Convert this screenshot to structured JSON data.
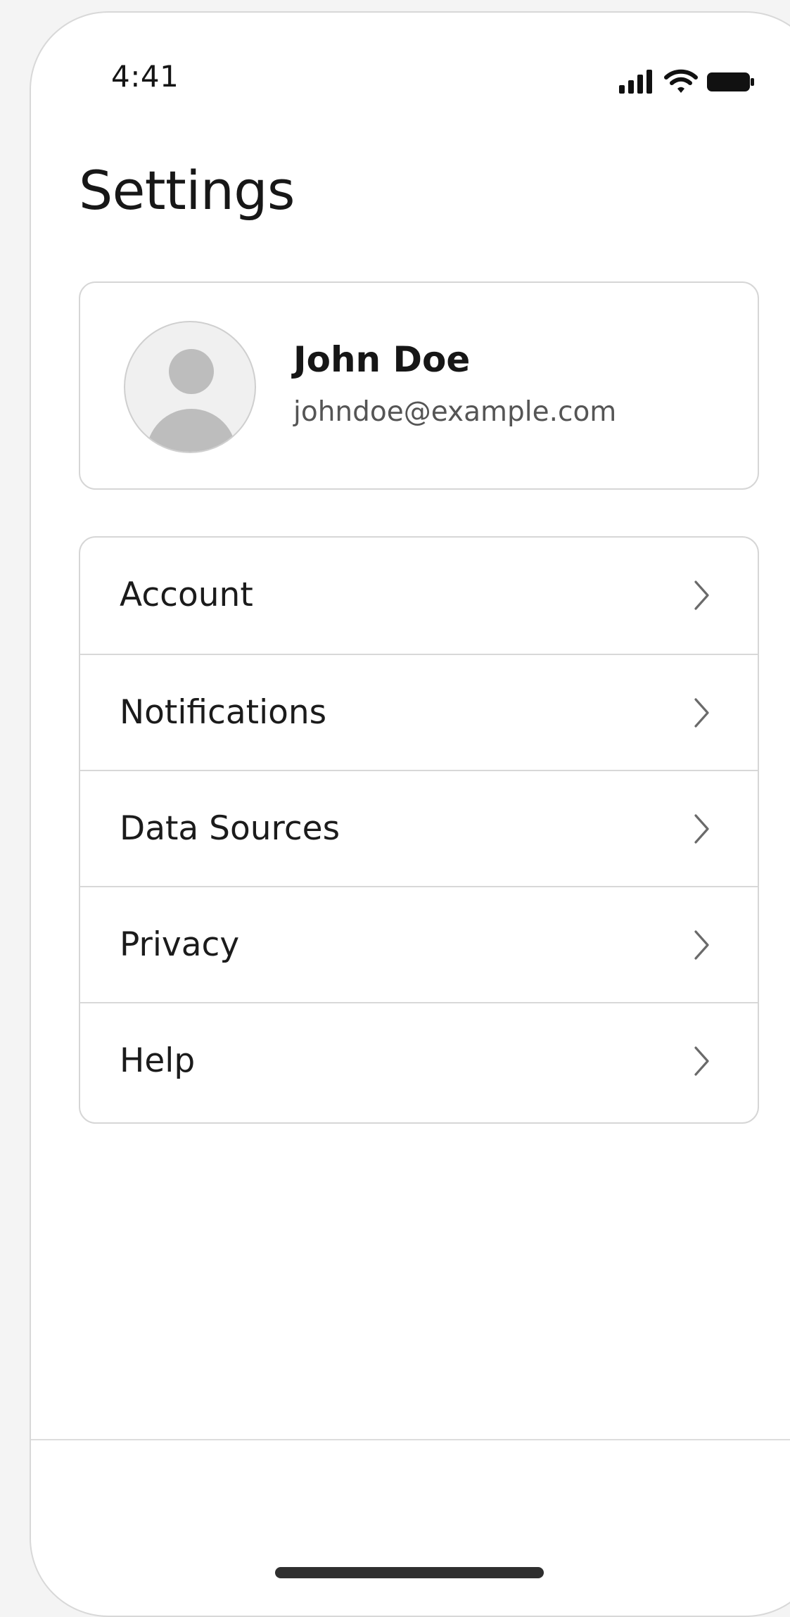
{
  "status_bar": {
    "time": "4:41",
    "icons": [
      "signal-icon",
      "wifi-icon",
      "battery-icon"
    ]
  },
  "header": {
    "title": "Settings"
  },
  "profile": {
    "name": "John Doe",
    "email": "johndoe@example.com",
    "avatar_icon": "user-avatar-placeholder-icon"
  },
  "menu": {
    "items": [
      {
        "label": "Account",
        "icon": "chevron-right-icon"
      },
      {
        "label": "Notifications",
        "icon": "chevron-right-icon"
      },
      {
        "label": "Data Sources",
        "icon": "chevron-right-icon"
      },
      {
        "label": "Privacy",
        "icon": "chevron-right-icon"
      },
      {
        "label": "Help",
        "icon": "chevron-right-icon"
      }
    ]
  },
  "colors": {
    "background": "#ffffff",
    "outer_background": "#f4f4f4",
    "text_primary": "#1b1b1b",
    "text_secondary": "#555555",
    "border": "#d6d6d6",
    "avatar_fill": "#bdbdbd"
  }
}
